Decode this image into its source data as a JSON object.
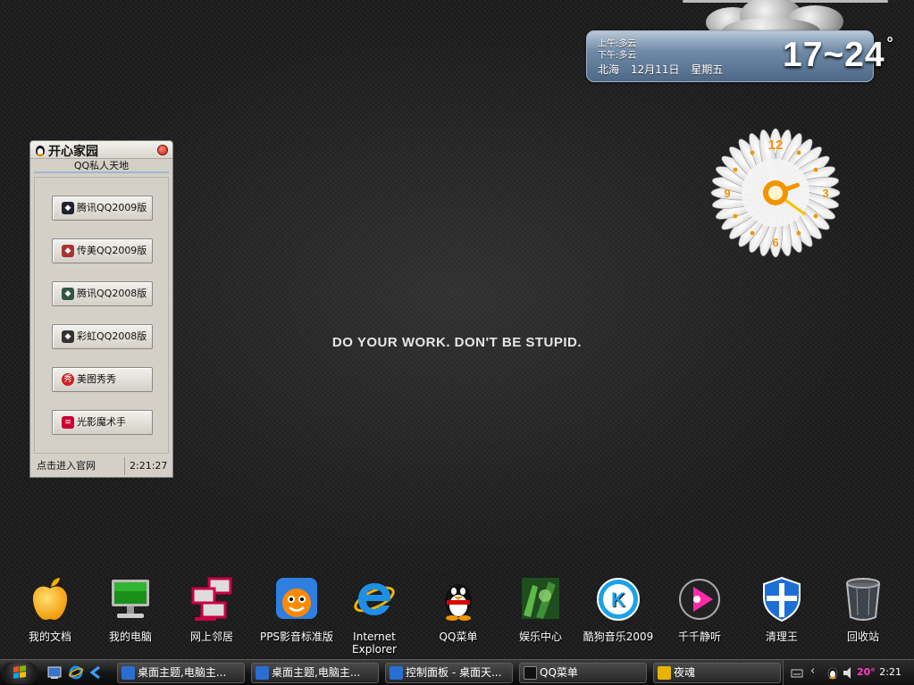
{
  "wallpaper": {
    "motto": "DO YOUR WORK. DON'T BE STUPID."
  },
  "weather": {
    "morning": "上午:多云",
    "afternoon": "下午:多云",
    "city": "北海",
    "date": "12月11日",
    "weekday": "星期五",
    "temperature": "17~24",
    "unit": "°"
  },
  "clock": {
    "numerals": [
      "12",
      "3",
      "6",
      "9"
    ],
    "hour_hand": 2,
    "minute_hand": 21
  },
  "qq_widget": {
    "title": "开心家园",
    "subtitle": "QQ私人天地",
    "buttons": [
      "腾讯QQ2009版",
      "传美QQ2009版",
      "腾讯QQ2008版",
      "彩虹QQ2008版",
      "美图秀秀",
      "光影魔术手"
    ],
    "footer_link": "点击进入官网",
    "footer_time": "2:21:27"
  },
  "desktop_icons": [
    {
      "label": "我的文档",
      "icon": "apple-icon"
    },
    {
      "label": "我的电脑",
      "icon": "computer-icon"
    },
    {
      "label": "网上邻居",
      "icon": "network-icon"
    },
    {
      "label": "PPS影音标准版",
      "icon": "pps-icon"
    },
    {
      "label": "Internet Explorer",
      "icon": "internet-explorer-icon"
    },
    {
      "label": "QQ菜单",
      "icon": "qq-penguin-icon"
    },
    {
      "label": "娱乐中心",
      "icon": "entertainment-icon"
    },
    {
      "label": "酷狗音乐2009",
      "icon": "kugou-icon"
    },
    {
      "label": "千千静听",
      "icon": "ttplayer-icon"
    },
    {
      "label": "清理王",
      "icon": "shield-icon"
    },
    {
      "label": "回收站",
      "icon": "recycle-bin-icon"
    }
  ],
  "taskbar": {
    "tasks": [
      "桌面主题,电脑主...",
      "桌面主题,电脑主...",
      "控制面板 - 桌面天...",
      "QQ菜单",
      "夜魂"
    ],
    "tray_temp": "20°",
    "time": "2:21"
  },
  "colors": {
    "accent_orange": "#f29400",
    "weather_blue": "#6f8aa6",
    "taskbar": "#1a1a1a"
  }
}
